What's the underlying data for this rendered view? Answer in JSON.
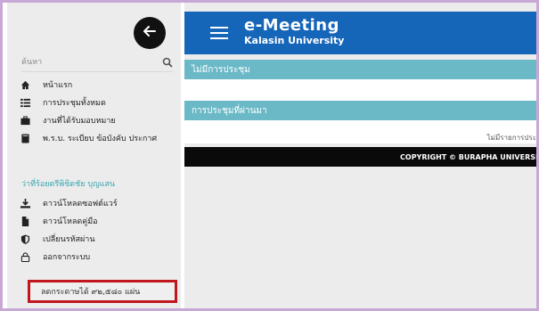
{
  "sidebar": {
    "back_icon": "arrow-left-icon",
    "search_label": "ค้นหา",
    "menu": [
      {
        "icon": "home-icon",
        "label": "หน้าแรก"
      },
      {
        "icon": "list-icon",
        "label": "การประชุมทั้งหมด"
      },
      {
        "icon": "briefcase-icon",
        "label": "งานที่ได้รับมอบหมาย"
      },
      {
        "icon": "book-icon",
        "label": "พ.ร.บ. ระเบียบ ข้อบังคับ ประกาศ"
      }
    ],
    "user_name": "ว่าที่ร้อยตรีพิชิตชัย บุญแสน",
    "menu2": [
      {
        "icon": "download-icon",
        "label": "ดาวน์โหลดซอฟต์แวร์"
      },
      {
        "icon": "file-icon",
        "label": "ดาวน์โหลดคู่มือ"
      },
      {
        "icon": "shield-icon",
        "label": "เปลี่ยนรหัสผ่าน"
      },
      {
        "icon": "lock-icon",
        "label": "ออกจากระบบ"
      }
    ],
    "paper_saved": "ลดกระดาษได้ ๙๒,๕๘๐ แผ่น"
  },
  "header": {
    "title": "e-Meeting",
    "subtitle": "Kalasin University"
  },
  "sections": {
    "no_meeting": "ไม่มีการประชุม",
    "past_meetings": "การประชุมที่ผ่านมา",
    "no_items": "ไม่มีรายการประ"
  },
  "footer": {
    "copyright": "COPYRIGHT © BURAPHA UNIVERSI"
  },
  "colors": {
    "header": "#1565b8",
    "section": "#6bb9c7",
    "highlight_border": "#c0171f",
    "outer_border": "#c8a9d6"
  }
}
